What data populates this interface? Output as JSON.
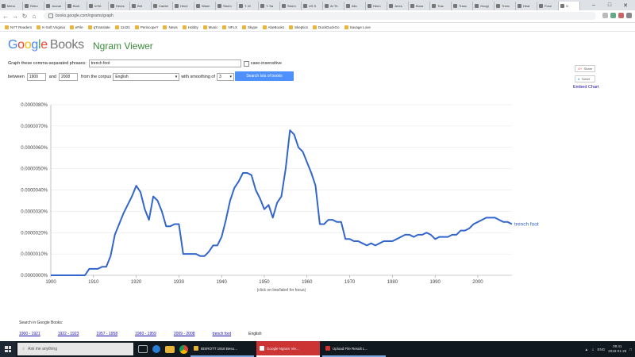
{
  "browser": {
    "tabs": [
      {
        "label": "Menu"
      },
      {
        "label": "Retro"
      },
      {
        "label": "Jounal"
      },
      {
        "label": "Bunt"
      },
      {
        "label": "InTel"
      },
      {
        "label": "Heres"
      },
      {
        "label": "Brit"
      },
      {
        "label": "Cambr"
      },
      {
        "label": "Henri"
      },
      {
        "label": "Warm"
      },
      {
        "label": "Storm"
      },
      {
        "label": "T. M"
      },
      {
        "label": "T. Sa"
      },
      {
        "label": "Storm"
      },
      {
        "label": "US S"
      },
      {
        "label": "At Th"
      },
      {
        "label": "Allo"
      },
      {
        "label": "Henn"
      },
      {
        "label": "Jeres"
      },
      {
        "label": "Buca"
      },
      {
        "label": "Trac"
      },
      {
        "label": "Tranc"
      },
      {
        "label": "Googl"
      },
      {
        "label": "Trenc"
      },
      {
        "label": "Hear"
      },
      {
        "label": "Fonz"
      },
      {
        "label": "G"
      }
    ],
    "active_tab_index": 26,
    "url": "books.google.com/ngrams/graph",
    "bookmarks": [
      "NYT Readers",
      "K-Soft Virginia",
      "eFile",
      "qTranslate",
      "11421",
      "Periscope?",
      "News",
      "Hobby",
      "Music",
      "NFLX",
      "Skype",
      "AbeBooks",
      "Skeptics",
      "DuckDuckGo",
      "Savage Love"
    ]
  },
  "header": {
    "logo_google": "Google",
    "logo_books": "Books",
    "title": "Ngram Viewer"
  },
  "form": {
    "phrases_label": "Graph these comma-separated phrases:",
    "phrases_value": "trench foot",
    "case_label": "case-insensitive",
    "between_label": "between",
    "start_year": "1900",
    "and_label": "and",
    "end_year": "2008",
    "corpus_label": "from the corpus",
    "corpus_value": "English",
    "smoothing_label": "with smoothing of",
    "smoothing_value": "3",
    "search_button": "Search lots of books"
  },
  "side": {
    "share": "Share",
    "tweet": "Tweet",
    "embed": "Embed Chart"
  },
  "chart_data": {
    "type": "line",
    "series": [
      {
        "name": "trench foot",
        "x": [
          1900,
          1904,
          1908,
          1909,
          1911,
          1912,
          1913,
          1914,
          1915,
          1916,
          1917,
          1918,
          1919,
          1920,
          1921,
          1922,
          1923,
          1924,
          1925,
          1926,
          1927,
          1928,
          1929,
          1930,
          1931,
          1932,
          1933,
          1934,
          1935,
          1936,
          1937,
          1938,
          1939,
          1940,
          1941,
          1942,
          1943,
          1944,
          1945,
          1946,
          1947,
          1948,
          1949,
          1950,
          1951,
          1952,
          1953,
          1954,
          1955,
          1956,
          1957,
          1958,
          1959,
          1960,
          1961,
          1962,
          1963,
          1964,
          1965,
          1966,
          1967,
          1968,
          1969,
          1970,
          1971,
          1972,
          1973,
          1974,
          1975,
          1976,
          1977,
          1978,
          1979,
          1980,
          1981,
          1982,
          1983,
          1984,
          1985,
          1986,
          1987,
          1988,
          1989,
          1990,
          1991,
          1992,
          1993,
          1994,
          1995,
          1996,
          1997,
          1998,
          1999,
          2000,
          2001,
          2002,
          2003,
          2004,
          2005,
          2006,
          2007,
          2008
        ],
        "y": [
          0.0,
          0.0,
          0.0,
          3e-07,
          3e-07,
          4e-07,
          4e-07,
          9e-07,
          1.9e-06,
          2.4e-06,
          2.9e-06,
          3.3e-06,
          3.7e-06,
          4.2e-06,
          3.9e-06,
          3.1e-06,
          2.6e-06,
          3.7e-06,
          3.5e-06,
          3e-06,
          2.3e-06,
          2.3e-06,
          2.4e-06,
          2.4e-06,
          1e-06,
          1e-06,
          1e-06,
          1e-06,
          9e-07,
          9e-07,
          1.1e-06,
          1.4e-06,
          1.4e-06,
          1.8e-06,
          2.6e-06,
          3.5e-06,
          4.1e-06,
          4.4e-06,
          4.8e-06,
          4.8e-06,
          4.7e-06,
          4e-06,
          3.6e-06,
          3.1e-06,
          3.3e-06,
          2.7e-06,
          3.4e-06,
          3.7e-06,
          5e-06,
          6.8e-06,
          6.6e-06,
          6e-06,
          5.8e-06,
          5.3e-06,
          4.8e-06,
          4.2e-06,
          2.4e-06,
          2.4e-06,
          2.6e-06,
          2.6e-06,
          2.5e-06,
          2.5e-06,
          1.7e-06,
          1.7e-06,
          1.6e-06,
          1.6e-06,
          1.5e-06,
          1.4e-06,
          1.5e-06,
          1.4e-06,
          1.5e-06,
          1.6e-06,
          1.6e-06,
          1.6e-06,
          1.7e-06,
          1.8e-06,
          1.9e-06,
          1.9e-06,
          1.8e-06,
          1.9e-06,
          1.9e-06,
          2e-06,
          1.9e-06,
          1.7e-06,
          1.8e-06,
          1.8e-06,
          1.8e-06,
          1.9e-06,
          1.9e-06,
          2.1e-06,
          2.1e-06,
          2.2e-06,
          2.4e-06,
          2.5e-06,
          2.6e-06,
          2.7e-06,
          2.7e-06,
          2.7e-06,
          2.6e-06,
          2.5e-06,
          2.5e-06,
          2.4e-06
        ]
      }
    ],
    "xticks": [
      "1900",
      "1910",
      "1920",
      "1930",
      "1940",
      "1950",
      "1960",
      "1970",
      "1980",
      "1990",
      "2000"
    ],
    "yticks": [
      "0.0000000%",
      "0.0000010%",
      "0.0000020%",
      "0.0000030%",
      "0.0000040%",
      "0.0000050%",
      "0.0000060%",
      "0.0000070%",
      "0.0000080%"
    ],
    "xlim": [
      1900,
      2008
    ],
    "ylim": [
      0,
      8e-06
    ],
    "xlabel": "(click on line/label for focus)",
    "ylabel": "",
    "line_color": "#3366cc"
  },
  "footer": {
    "search_label": "Search in Google Books:",
    "links": [
      "1900 - 1921",
      "1922 - 1923",
      "1957 - 1958",
      "1960 - 1959",
      "2009 - 2008",
      "trench foot"
    ],
    "corpus": "English"
  },
  "taskbar": {
    "search_placeholder": "Ask me anything",
    "tasks": [
      "IBSROTT 1918 Beso...",
      "Google Ngram Vie...",
      "Upload File Result L..."
    ],
    "active_task_index": 1,
    "lang": "ENG",
    "time": "09:41",
    "date": "2018-01-28"
  }
}
